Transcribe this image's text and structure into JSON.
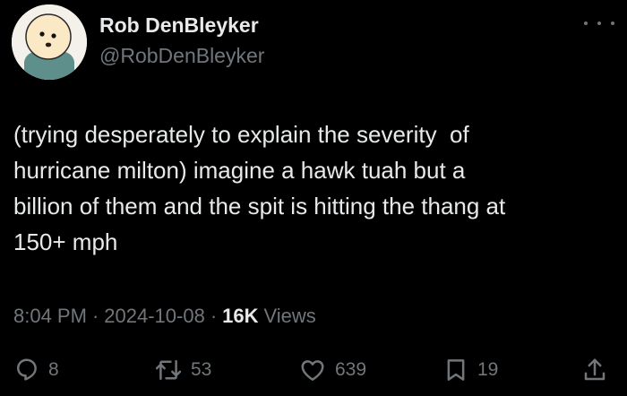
{
  "author": {
    "name": "Rob DenBleyker",
    "handle": "@RobDenBleyker"
  },
  "tweet": {
    "lines": [
      "(trying desperately to explain the severity  of",
      "hurricane milton) imagine a hawk tuah but a",
      "billion of them and the spit is hitting the thang at",
      "150+ mph"
    ]
  },
  "meta": {
    "time": "8:04 PM",
    "separator": "·",
    "date": "2024-10-08",
    "views_count": "16K",
    "views_label": "Views"
  },
  "actions": {
    "replies": "8",
    "retweets": "53",
    "likes": "639",
    "bookmarks": "19"
  },
  "icons": {
    "avatar": "avatar-icon",
    "more": "more-icon",
    "reply": "reply-icon",
    "retweet": "retweet-icon",
    "like": "heart-icon",
    "bookmark": "bookmark-icon",
    "share": "share-icon"
  },
  "colors": {
    "background": "#000000",
    "text": "#e7e9ea",
    "secondary": "#71767b"
  }
}
